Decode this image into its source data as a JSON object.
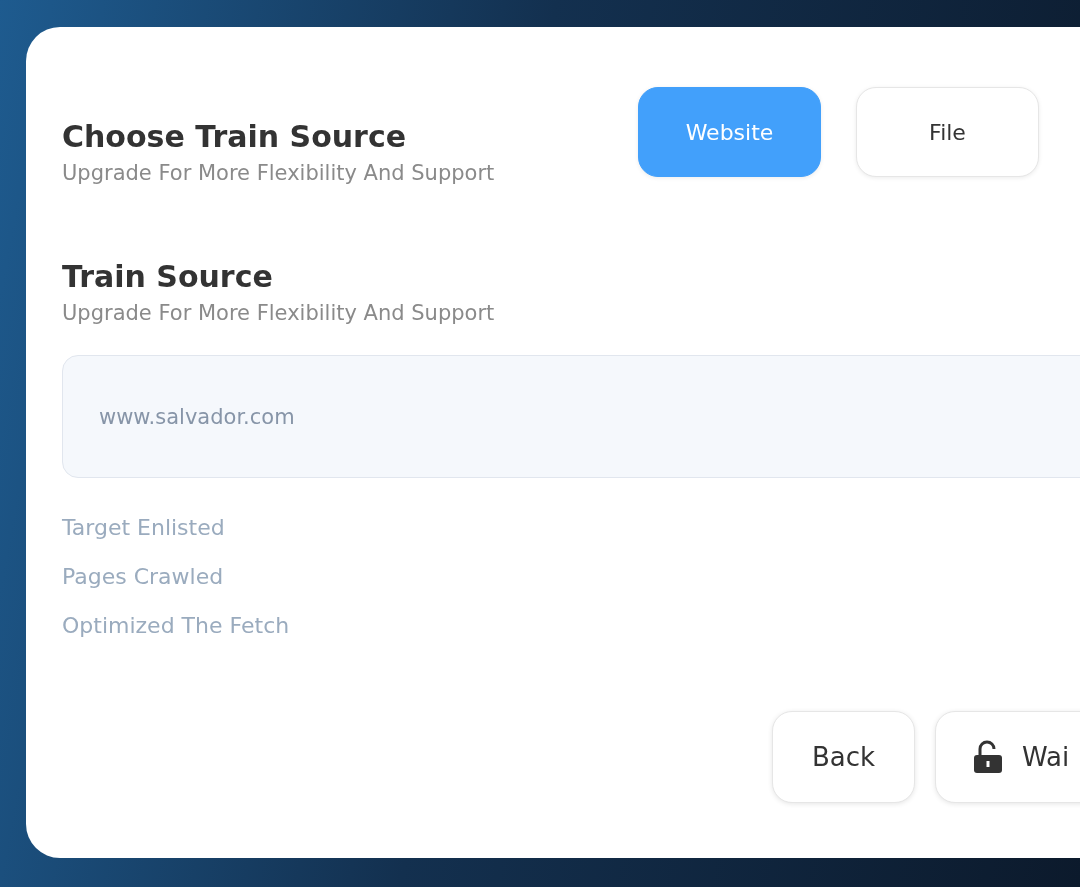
{
  "header": {
    "title": "Choose Train Source",
    "subtitle": "Upgrade For More Flexibility And Support"
  },
  "source_options": [
    {
      "label": "Website",
      "selected": true
    },
    {
      "label": "File",
      "selected": false
    }
  ],
  "section": {
    "title": "Train Source",
    "subtitle": "Upgrade For More Flexibility And Support"
  },
  "url_field": {
    "placeholder": "www.salvador.com"
  },
  "status_items": [
    "Target Enlisted",
    "Pages Crawled",
    "Optimized The Fetch"
  ],
  "actions": [
    {
      "label": "Back",
      "kind": "plain"
    },
    {
      "label": "Wai",
      "kind": "lock"
    }
  ]
}
